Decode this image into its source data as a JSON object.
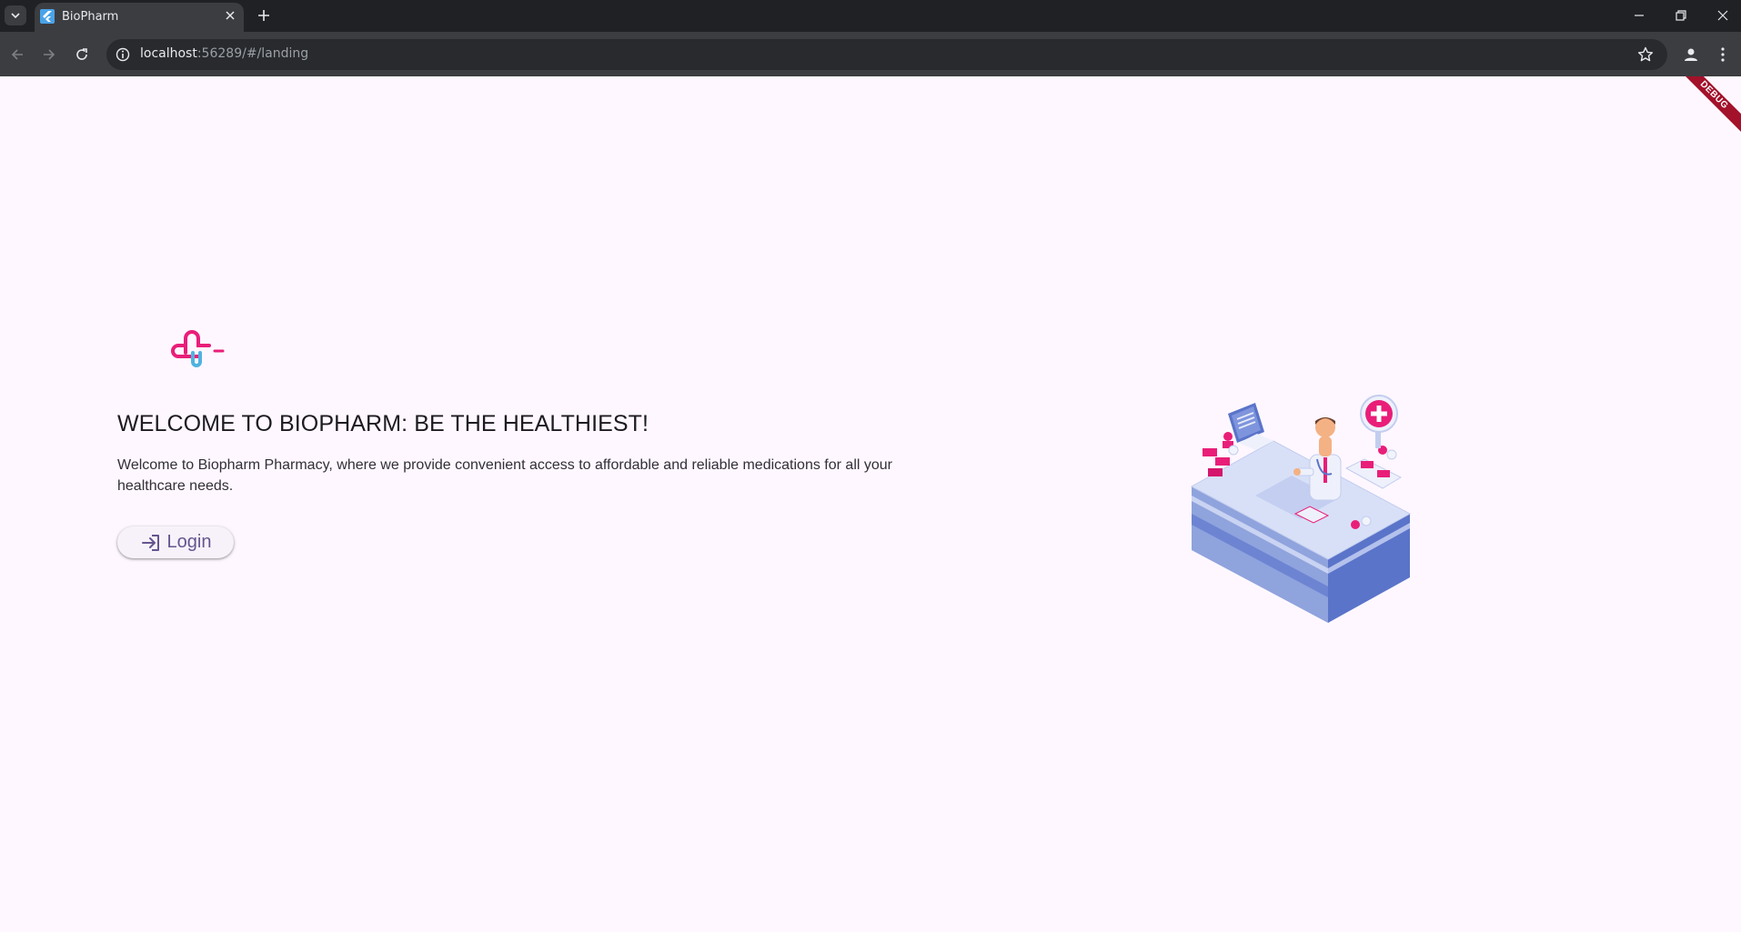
{
  "browser": {
    "tab_title": "BioPharm",
    "url_host": "localhost",
    "url_rest": ":56289/#/landing"
  },
  "page": {
    "debug_banner": "DEBUG",
    "headline": "WELCOME TO BIOPHARM: BE THE HEALTHIEST!",
    "subtitle": "Welcome to Biopharm Pharmacy, where we provide convenient access to affordable and reliable medications for all your healthcare needs.",
    "login_label": "Login"
  },
  "icons": {
    "logo": "biopharm-cross-logo",
    "login": "login-arrow-icon",
    "illustration": "pharmacist-counter-illustration"
  },
  "colors": {
    "background": "#fef7ff",
    "accent": "#65558f",
    "logo_pink": "#e91e79",
    "logo_blue": "#4fb3e0"
  }
}
